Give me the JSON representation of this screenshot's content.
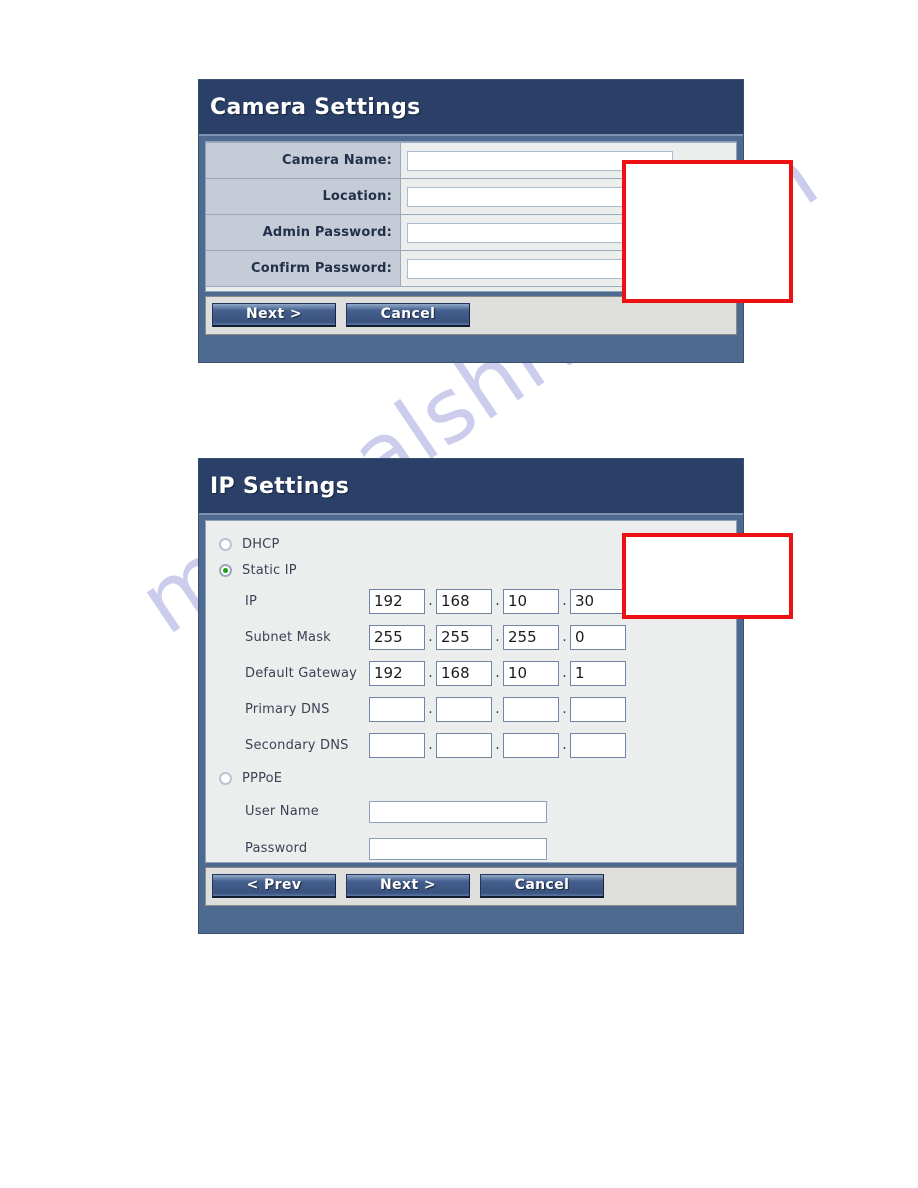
{
  "watermark": {
    "text": "manualshive.com"
  },
  "camera_settings": {
    "title": "Camera Settings",
    "fields": [
      {
        "label": "Camera Name:",
        "value": ""
      },
      {
        "label": "Location:",
        "value": ""
      },
      {
        "label": "Admin Password:",
        "value": ""
      },
      {
        "label": "Confirm Password:",
        "value": ""
      }
    ],
    "buttons": [
      {
        "label": "Next >"
      },
      {
        "label": "Cancel"
      }
    ]
  },
  "ip_settings": {
    "title": "IP Settings",
    "modes": [
      {
        "label": "DHCP",
        "selected": false
      },
      {
        "label": "Static IP",
        "selected": true
      },
      {
        "label": "PPPoE",
        "selected": false
      }
    ],
    "static_rows": [
      {
        "label": "IP",
        "octets": [
          "192",
          "168",
          "10",
          "30"
        ]
      },
      {
        "label": "Subnet Mask",
        "octets": [
          "255",
          "255",
          "255",
          "0"
        ]
      },
      {
        "label": "Default Gateway",
        "octets": [
          "192",
          "168",
          "10",
          "1"
        ]
      },
      {
        "label": "Primary DNS",
        "octets": [
          "",
          "",
          "",
          ""
        ]
      },
      {
        "label": "Secondary DNS",
        "octets": [
          "",
          "",
          "",
          ""
        ]
      }
    ],
    "pppoe_rows": [
      {
        "label": "User Name",
        "value": ""
      },
      {
        "label": "Password",
        "value": ""
      }
    ],
    "buttons": [
      {
        "label": "< Prev"
      },
      {
        "label": "Next >"
      },
      {
        "label": "Cancel"
      }
    ]
  },
  "annotations": {
    "accent_color": "#ee1111",
    "boxes": [
      {
        "name": "camera-settings-callout",
        "text": ""
      },
      {
        "name": "ip-settings-callout",
        "text": ""
      }
    ]
  }
}
